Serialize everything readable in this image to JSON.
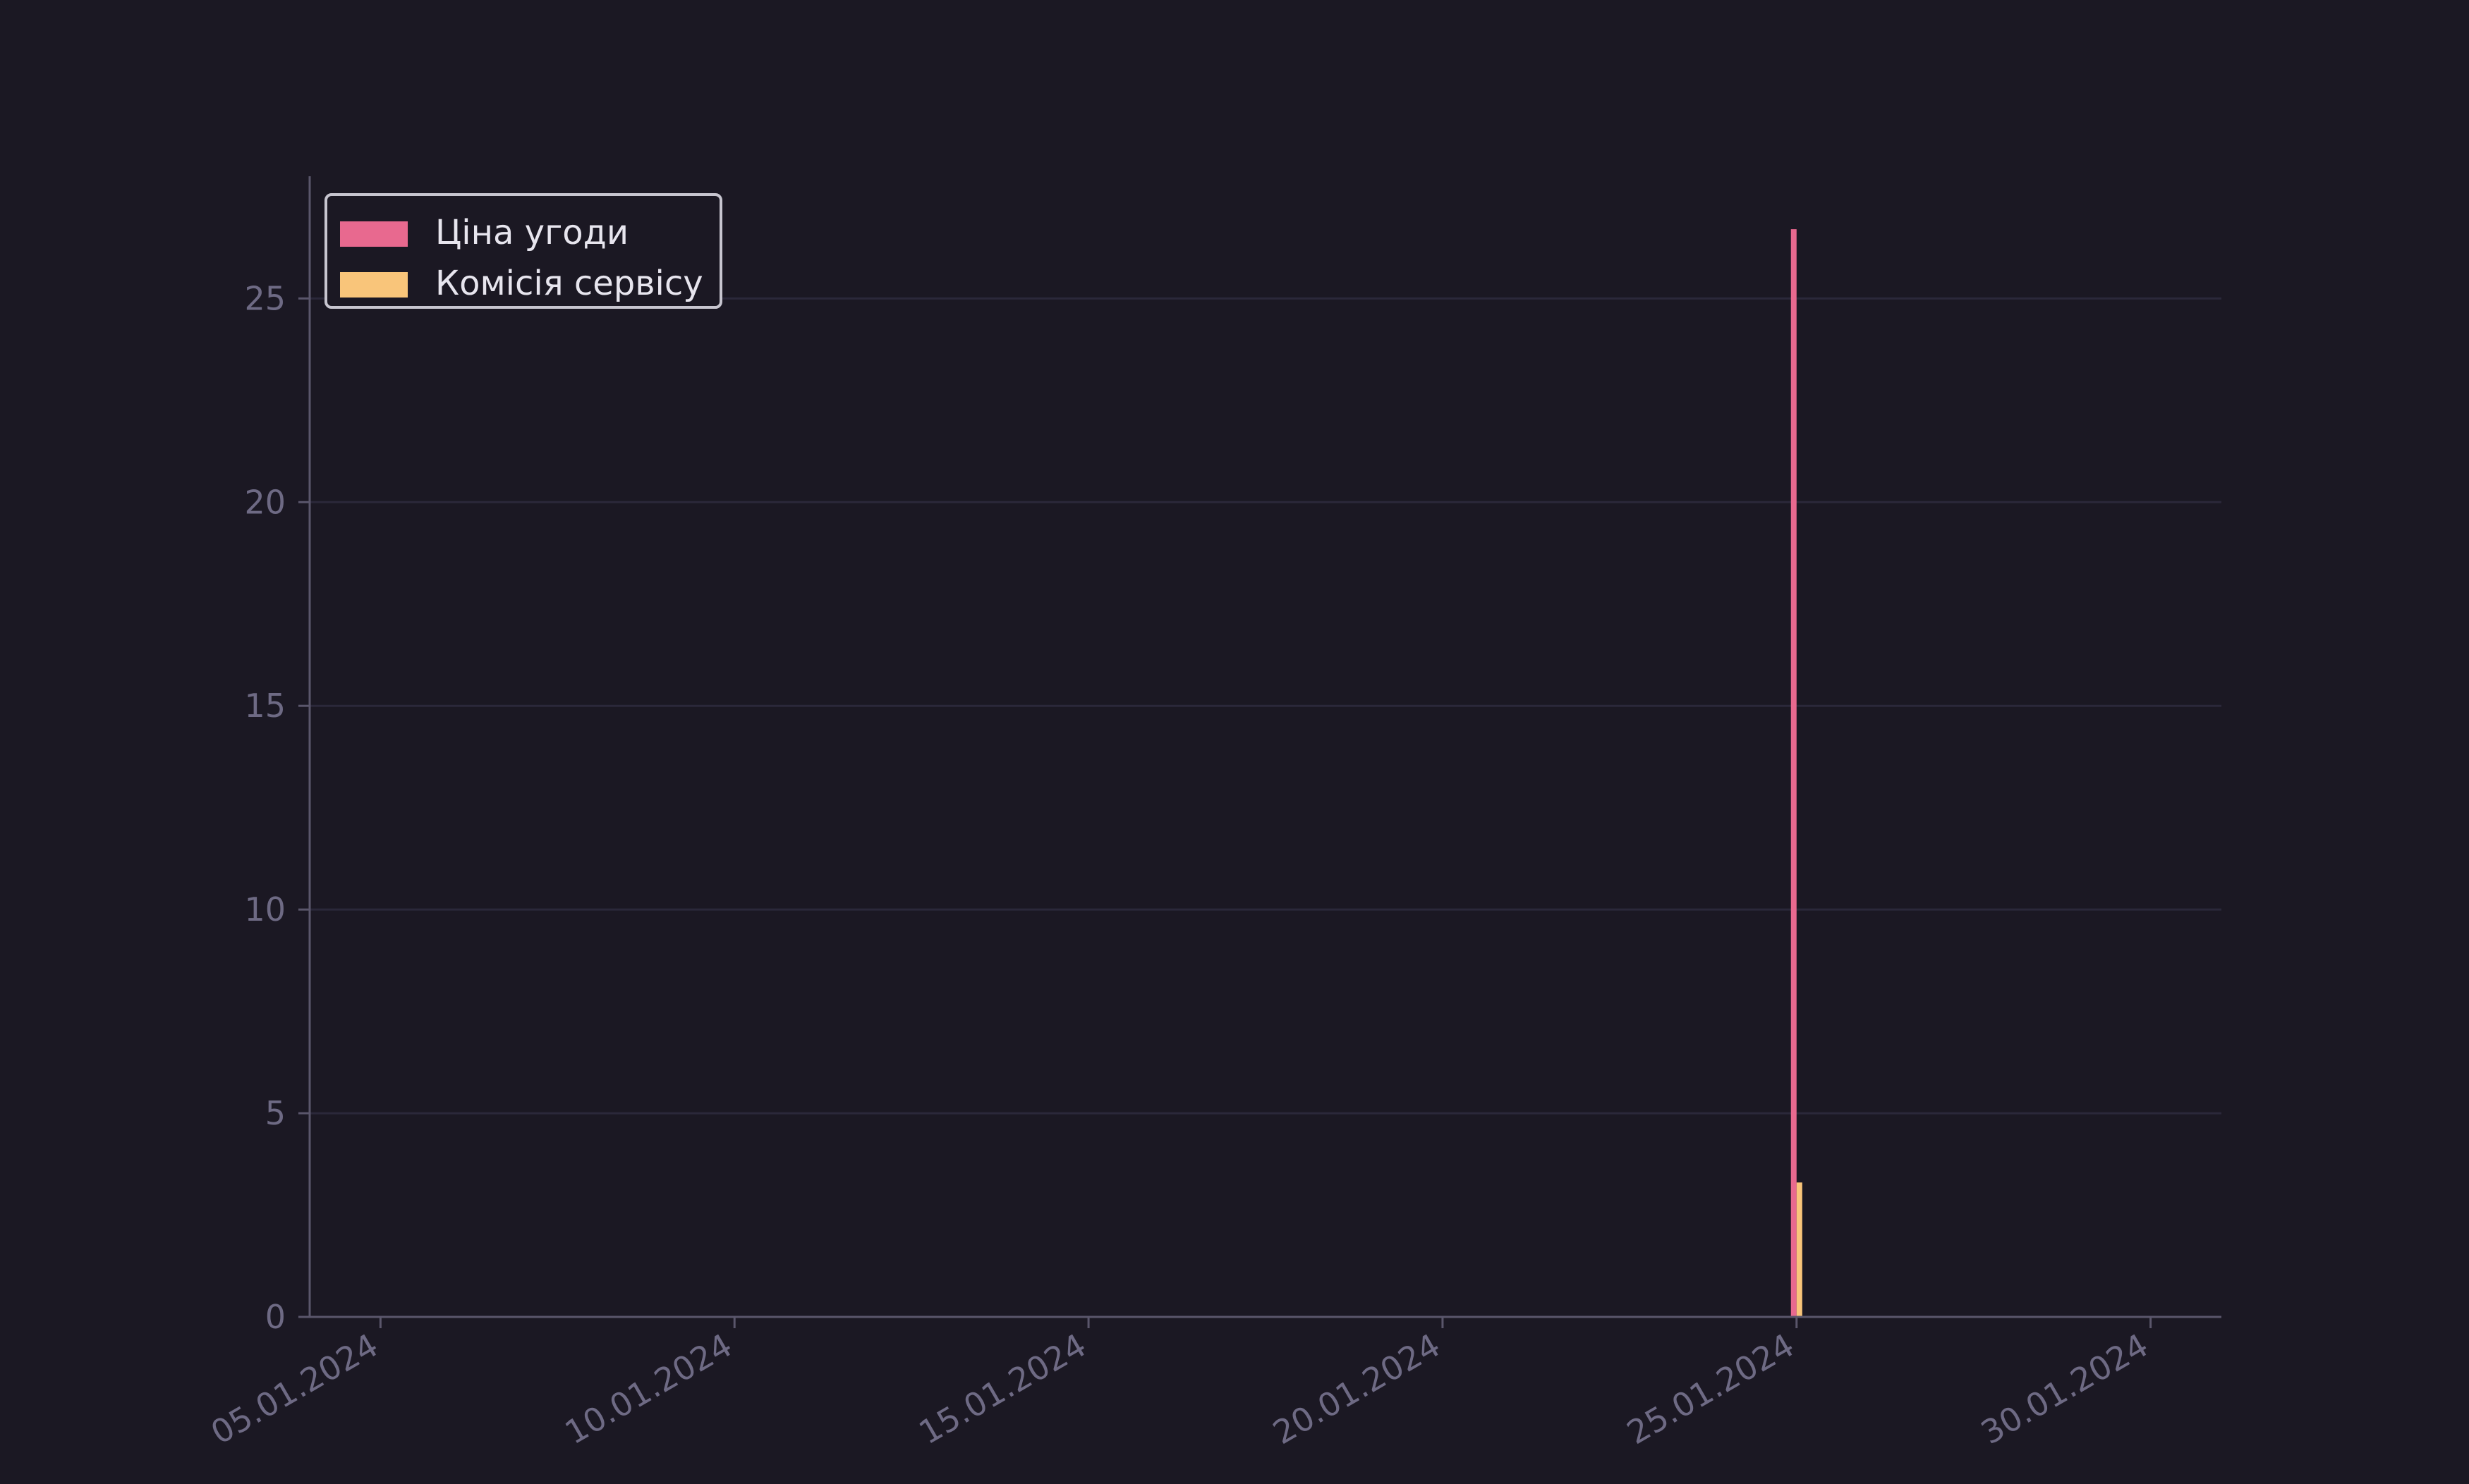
{
  "chart_data": {
    "type": "bar",
    "title": "",
    "xlabel": "",
    "ylabel": "",
    "x_ticks": [
      "05.01.2024",
      "10.01.2024",
      "15.01.2024",
      "20.01.2024",
      "25.01.2024",
      "30.01.2024"
    ],
    "y_ticks": [
      "0",
      "5",
      "10",
      "15",
      "20",
      "25"
    ],
    "xlim": [
      "2024-01-04",
      "2024-01-31"
    ],
    "ylim": [
      0,
      28
    ],
    "grid": "horizontal",
    "legend_position": "top-left",
    "series": [
      {
        "name": "Ціна угоди",
        "color": "#e8698f",
        "points": [
          {
            "x": "2024-01-25",
            "y": 26.7
          }
        ]
      },
      {
        "name": "Комісія сервісу",
        "color": "#f9c57a",
        "points": [
          {
            "x": "2024-01-25",
            "y": 3.3
          }
        ]
      }
    ]
  }
}
